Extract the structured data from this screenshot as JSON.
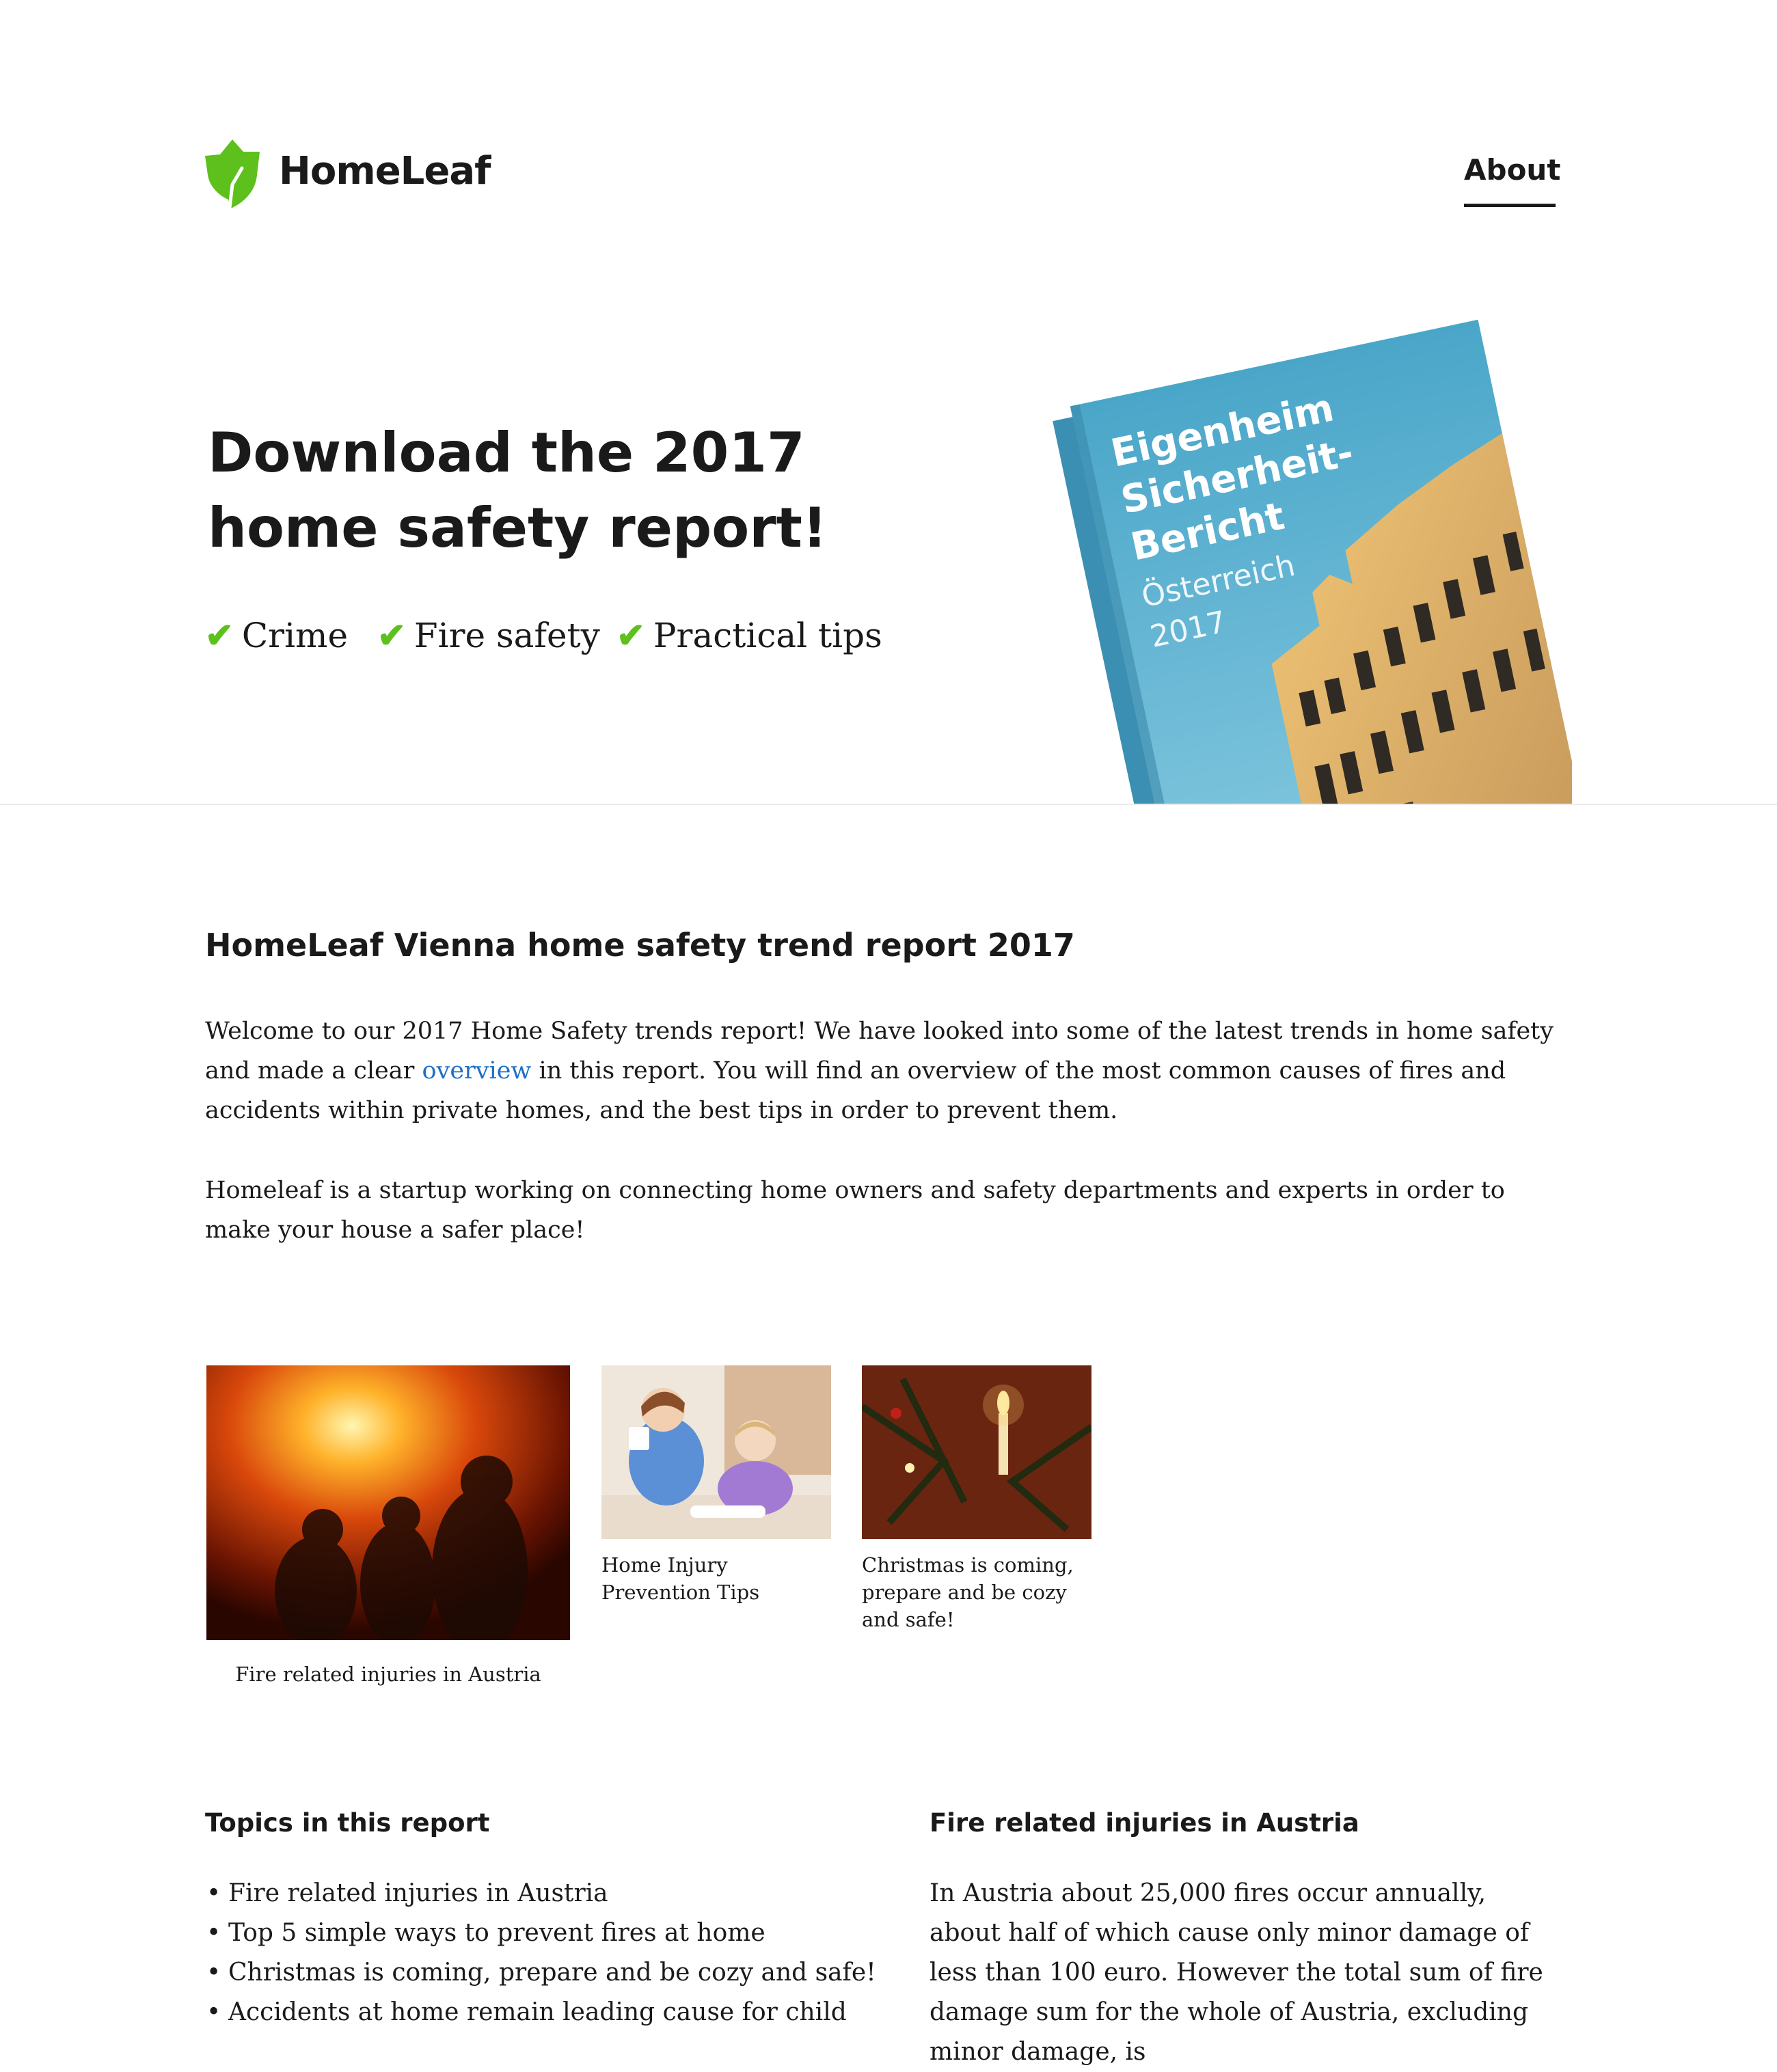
{
  "header": {
    "brand": "HomeLeaf",
    "nav_about": "About",
    "brand_color": "#5dc01d"
  },
  "hero": {
    "title_line1": "Download the 2017",
    "title_line2": "home safety report!",
    "checks": [
      "Crime",
      "Fire safety",
      "Practical tips"
    ],
    "check_glyph": "✔",
    "book": {
      "title_lines": [
        "Eigenheim",
        "Sicherheit-",
        "Bericht"
      ],
      "subtitle_lines": [
        "Österreich",
        "2017"
      ],
      "cover_color": "#4aa6c9"
    }
  },
  "intro": {
    "section_title": "HomeLeaf Vienna home safety trend report 2017",
    "p1_before": "Welcome to our 2017 Home Safety trends report! We have looked into some of the latest trends in home safety and made a clear ",
    "p1_link": "overview",
    "p1_after": " in this report. You will find an overview of the most common causes of fires and accidents within private homes, and the best tips in order to prevent them.",
    "p2": "Homeleaf is a startup working on connecting home owners and safety departments and experts in order to make your house a safer place!"
  },
  "cards": [
    {
      "caption": "Fire related injuries in Austria",
      "image": "firefighters-photo"
    },
    {
      "caption": "Home Injury Prevention Tips",
      "image": "children-plug-photo"
    },
    {
      "caption": "Christmas is coming, prepare and be cozy and safe!",
      "image": "christmas-candle-photo"
    }
  ],
  "topics": {
    "title": "Topics in this report",
    "items": [
      "Fire related injuries in Austria",
      "Top 5 simple ways to prevent fires at home",
      "Christmas is coming, prepare and be cozy and safe!",
      "Accidents at home remain leading cause for child"
    ]
  },
  "fire_section": {
    "title": "Fire related injuries in Austria",
    "text": "In Austria about 25,000 fires occur annually, about half of which cause only minor damage of less than 100 euro. However the total sum of fire damage sum for the whole of Austria, excluding minor damage, is"
  },
  "colors": {
    "text": "#1a1a1a",
    "link": "#1e6fc8",
    "check": "#5dc01d"
  }
}
